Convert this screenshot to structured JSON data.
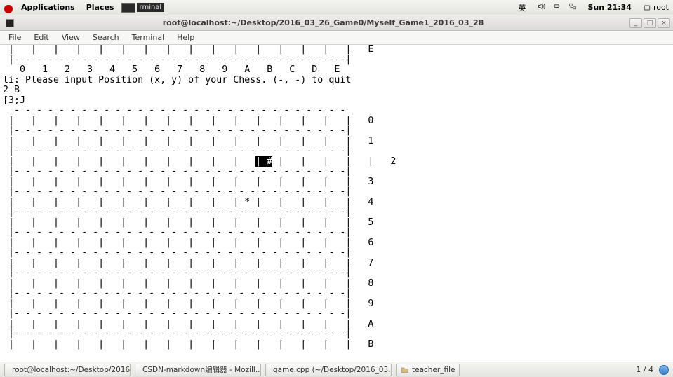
{
  "gnome_bar": {
    "applications": "Applications",
    "places": "Places",
    "thumb_label": "rminal",
    "ime": "英",
    "clock": "Sun 21:34",
    "user": "root"
  },
  "titlebar": {
    "title": "root@localhost:~/Desktop/2016_03_26_Game0/Myself_Game1_2016_03_28"
  },
  "menubar": {
    "file": "File",
    "edit": "Edit",
    "view": "View",
    "search": "Search",
    "terminal": "Terminal",
    "help": "Help"
  },
  "terminal": {
    "line1": " |   |   |   |   |   |   |   |   |   |   |   |   |   |   |   |   E",
    "line2": " |- - - - - - - - - - - - - - - - - - - - - - - - - - - - - -|",
    "line3": "   0   1   2   3   4   5   6   7   8   9   A   B   C   D   E",
    "line4": "li: Please input Position (x, y) of your Chess. (-, -) to quit",
    "line5": "2 B",
    "line6": "[3;J",
    "line7": "  - - - - - - - - - - - - - - - - - - - - - - - - - - - - - -",
    "row0": " |   |   |   |   |   |   |   |   |   |   |   |   |   |   |   |   0",
    "dash": " |- - - - - - - - - - - - - - - - - - - - - - - - - - - - - -|",
    "row1": " |   |   |   |   |   |   |   |   |   |   |   |   |   |   |   |   1",
    "row2_pre": " |   |   |   |   |   |   |   |   |   |   |   ",
    "row2_sel": "| #",
    "row2_post": " |   |   |   |   |   2",
    "row3": " |   |   |   |   |   |   |   |   |   |   |   |   |   |   |   |   3",
    "row4": " |   |   |   |   |   |   |   |   |   |   | * |   |   |   |   |   4",
    "row5": " |   |   |   |   |   |   |   |   |   |   |   |   |   |   |   |   5",
    "row6": " |   |   |   |   |   |   |   |   |   |   |   |   |   |   |   |   6",
    "row7": " |   |   |   |   |   |   |   |   |   |   |   |   |   |   |   |   7",
    "row8": " |   |   |   |   |   |   |   |   |   |   |   |   |   |   |   |   8",
    "row9": " |   |   |   |   |   |   |   |   |   |   |   |   |   |   |   |   9",
    "rowA": " |   |   |   |   |   |   |   |   |   |   |   |   |   |   |   |   A",
    "rowB": " |   |   |   |   |   |   |   |   |   |   |   |   |   |   |   |   B"
  },
  "taskbar": {
    "task1": "root@localhost:~/Desktop/2016...",
    "task2": "CSDN-markdown编辑器 - Mozill...",
    "task3": "game.cpp (~/Desktop/2016_03...",
    "task4": "teacher_file",
    "workspace": "1 / 4"
  }
}
